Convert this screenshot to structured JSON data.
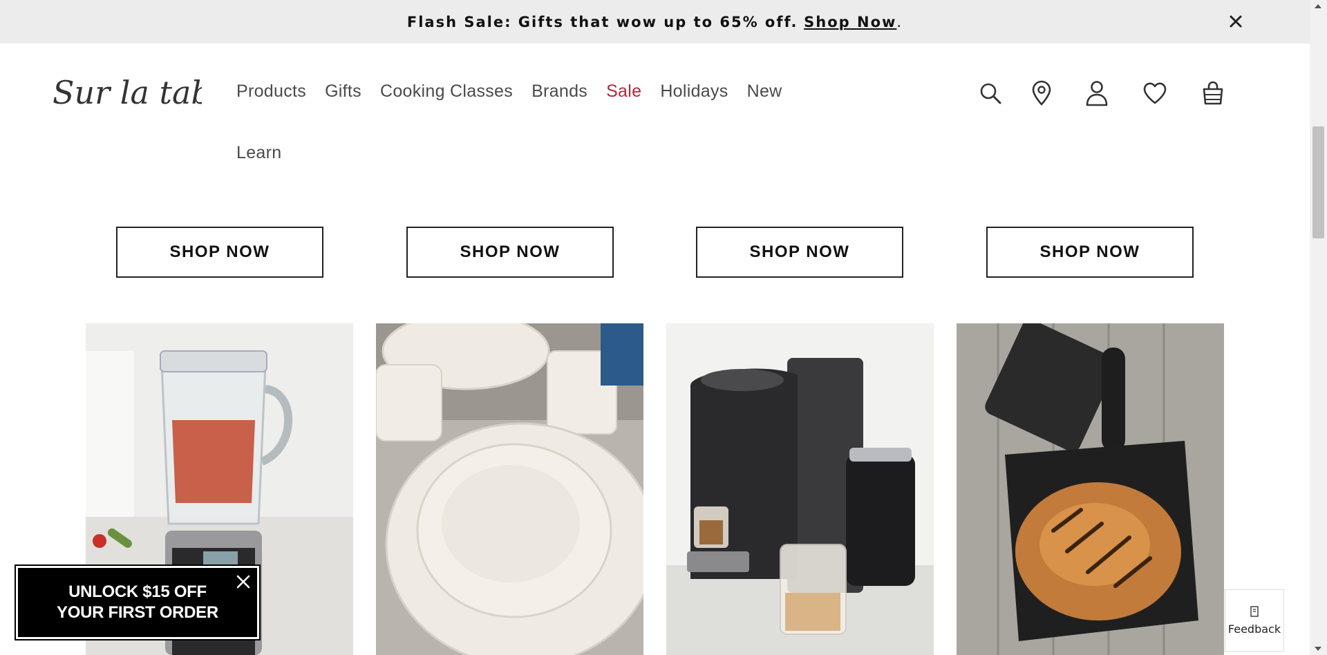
{
  "banner": {
    "text": "Flash Sale: Gifts that wow up to 65% off.",
    "link": "Shop Now",
    "suffix": "."
  },
  "brand": {
    "logo_text": "Sur la table"
  },
  "nav": {
    "items": [
      {
        "label": "Products"
      },
      {
        "label": "Gifts"
      },
      {
        "label": "Cooking Classes"
      },
      {
        "label": "Brands"
      },
      {
        "label": "Sale",
        "color": "#b0283a"
      },
      {
        "label": "Holidays"
      },
      {
        "label": "New"
      }
    ],
    "second_row": [
      {
        "label": "Learn"
      }
    ]
  },
  "header_icons": [
    "search-icon",
    "location-pin-icon",
    "account-icon",
    "heart-icon",
    "shopping-bag-icon"
  ],
  "categories": [
    {
      "button": "SHOP NOW",
      "image": "blender"
    },
    {
      "button": "SHOP NOW",
      "image": "dinnerware"
    },
    {
      "button": "SHOP NOW",
      "image": "coffee-machine"
    },
    {
      "button": "SHOP NOW",
      "image": "cast-iron-pan-chicken"
    }
  ],
  "promo": {
    "line1": "UNLOCK $15 OFF",
    "line2": "YOUR FIRST ORDER"
  },
  "feedback": {
    "label": "Feedback"
  },
  "colors": {
    "banner_bg": "#ececec",
    "sale": "#b0283a",
    "text": "#4a4a4a"
  }
}
